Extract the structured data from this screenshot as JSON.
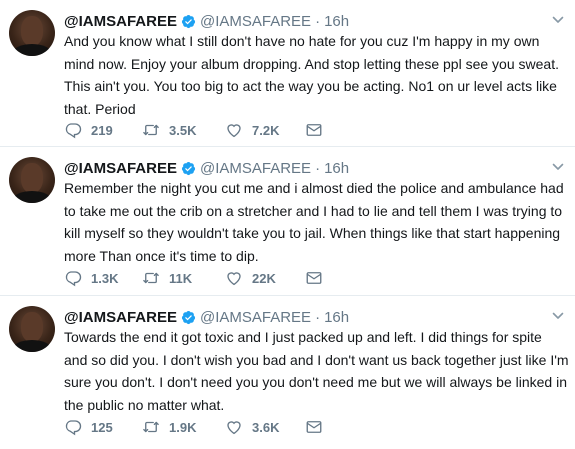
{
  "tweets": [
    {
      "display_name": "@IAMSAFAREE",
      "handle": "@IAMSAFAREE",
      "separator": "·",
      "time": "16h",
      "text": "And you know what I still don't have no hate for you cuz I'm happy in my own mind now. Enjoy your album dropping. And stop letting these ppl see you sweat. This ain't you. You too big to act the way you be acting. No1 on ur level acts like that. Period",
      "replies": "219",
      "retweets": "3.5K",
      "likes": "7.2K"
    },
    {
      "display_name": "@IAMSAFAREE",
      "handle": "@IAMSAFAREE",
      "separator": "·",
      "time": "16h",
      "text": "Remember the night you cut me and i almost died the police and ambulance had to take me out the crib on a stretcher and I had to lie and tell them I was trying to kill myself so they wouldn't take you to jail. When things like that start happening more Than once it's time to dip.",
      "replies": "1.3K",
      "retweets": "11K",
      "likes": "22K"
    },
    {
      "display_name": "@IAMSAFAREE",
      "handle": "@IAMSAFAREE",
      "separator": "·",
      "time": "16h",
      "text": "Towards the end it got toxic and I just packed up and left. I did things for spite and so did you. I don't wish you bad and I don't want us back together just like I'm sure you don't. I don't need you you don't need me but we will always be linked in the public no matter what.",
      "replies": "125",
      "retweets": "1.9K",
      "likes": "3.6K"
    }
  ],
  "icons": {
    "reply": "reply-icon",
    "retweet": "retweet-icon",
    "like": "heart-icon",
    "dm": "envelope-icon",
    "verified": "verified-badge-icon",
    "caret": "chevron-down-icon"
  },
  "colors": {
    "verified": "#1da1f2",
    "secondary_text": "#657786",
    "border": "#e6ecf0"
  }
}
